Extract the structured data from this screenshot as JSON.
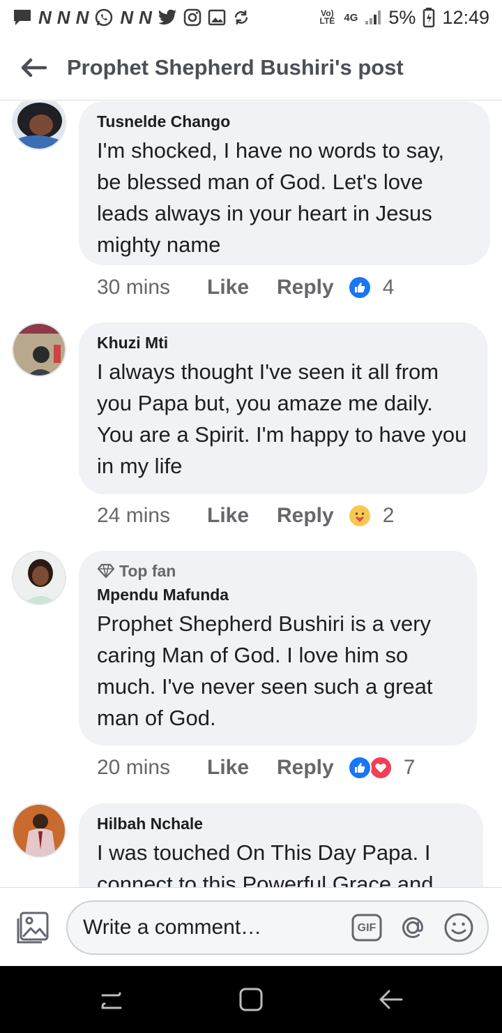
{
  "status_bar": {
    "network_label": "Vo) LTE",
    "network_type": "4G",
    "battery": "5%",
    "time": "12:49"
  },
  "header": {
    "title": "Prophet Shepherd Bushiri's post"
  },
  "comments": [
    {
      "author": "Tusnelde Chango",
      "text": "I'm shocked, I have no words to say, be blessed man of God. Let's love leads always in your heart in Jesus mighty name",
      "time": "30 mins",
      "like_label": "Like",
      "reply_label": "Reply",
      "reactions": [
        "like"
      ],
      "reaction_count": "4"
    },
    {
      "author": "Khuzi Mti",
      "text": "I always thought I've seen it all from you Papa but, you amaze me daily. You are a Spirit. I'm happy to have you in my life",
      "time": "24 mins",
      "like_label": "Like",
      "reply_label": "Reply",
      "reactions": [
        "care"
      ],
      "reaction_count": "2"
    },
    {
      "badge": "Top fan",
      "author": "Mpendu Mafunda",
      "text": "Prophet Shepherd Bushiri is a very caring Man of God. I love him so much. I've never seen such a great man of God.",
      "time": "20 mins",
      "like_label": "Like",
      "reply_label": "Reply",
      "reactions": [
        "like",
        "love"
      ],
      "reaction_count": "7"
    },
    {
      "author": "Hilbah Nchale",
      "text": "I was touched On This Day Papa. I connect to this Powerful Grace and"
    }
  ],
  "composer": {
    "placeholder": "Write a comment…",
    "gif_label": "GIF"
  },
  "colors": {
    "like_blue": "#1877f2",
    "love_red": "#f33e58",
    "bubble": "#f0f2f5",
    "muted_text": "#65676b"
  }
}
